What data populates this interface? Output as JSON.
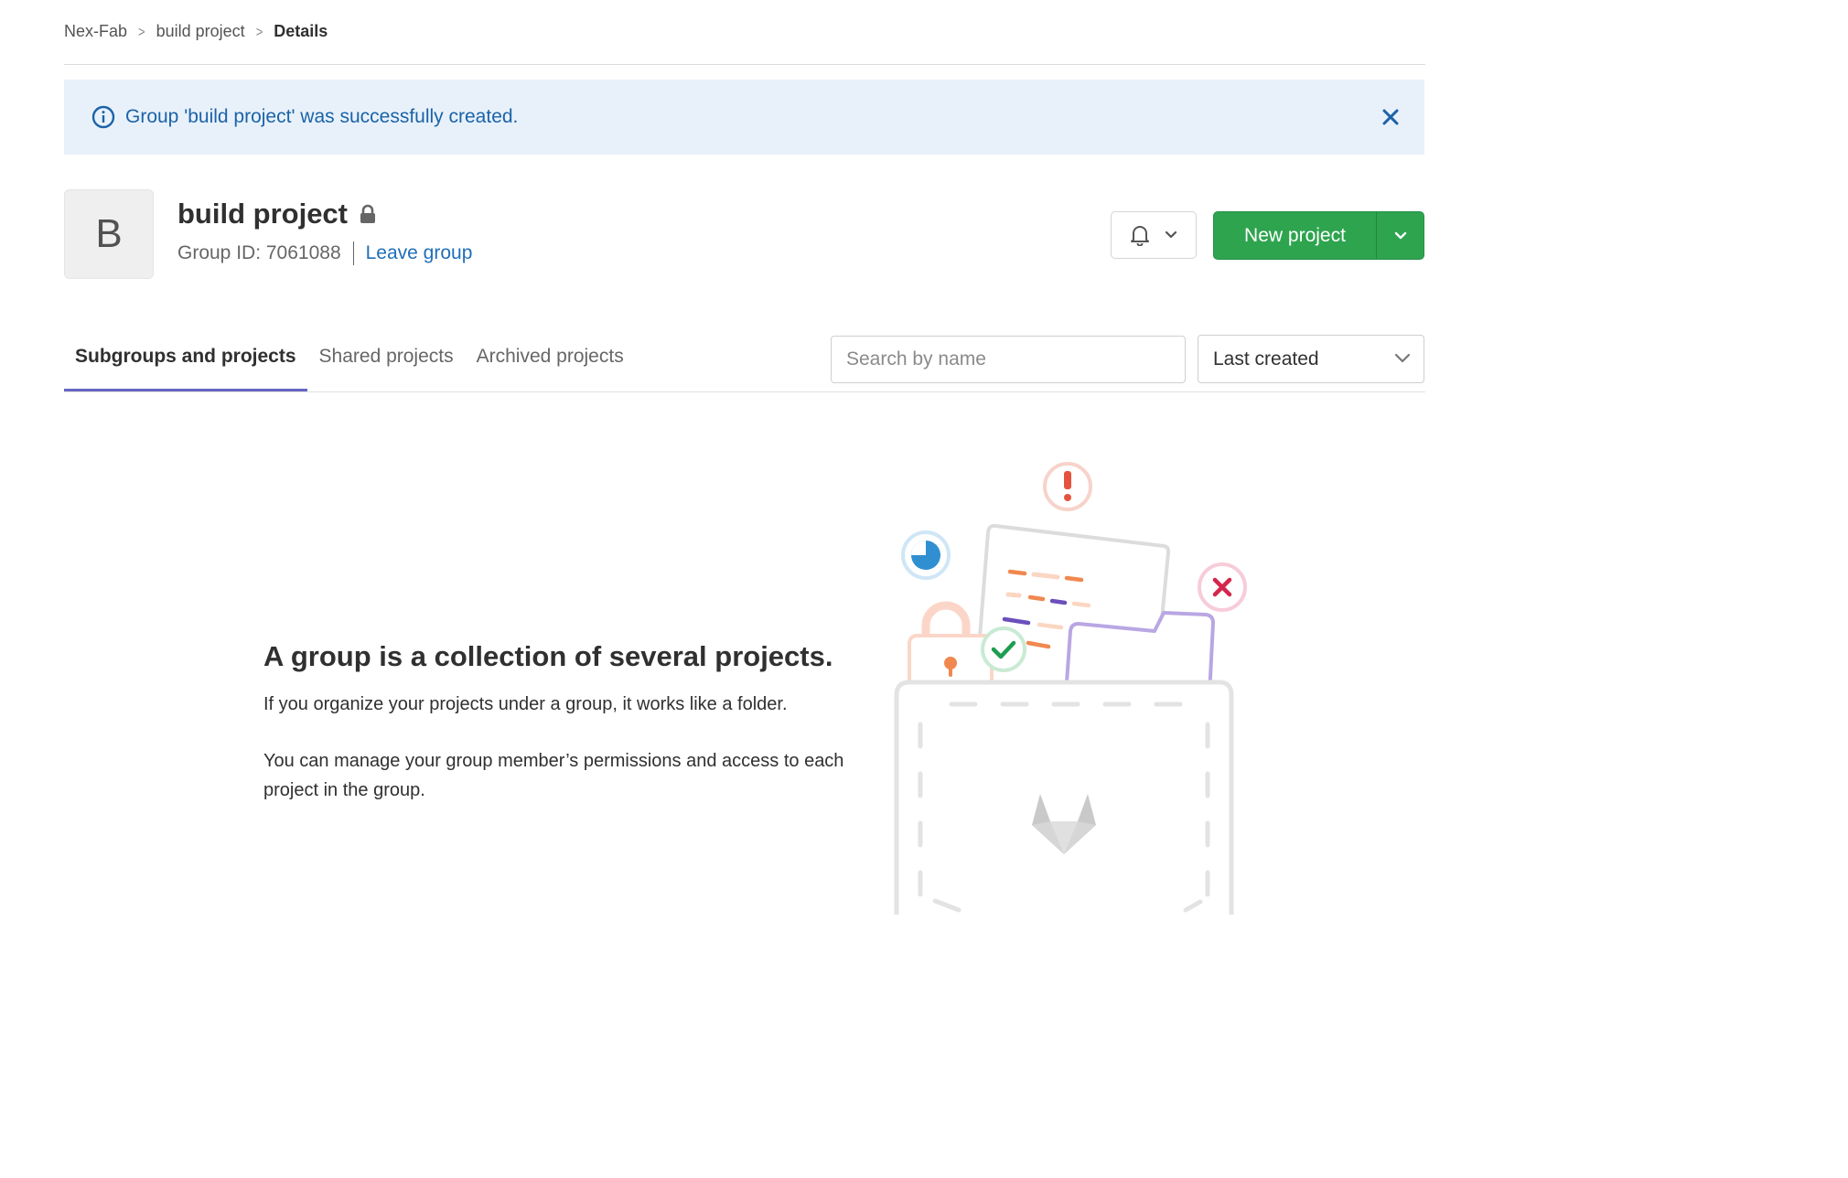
{
  "breadcrumb": {
    "items": [
      "Nex-Fab",
      "build project"
    ],
    "current": "Details"
  },
  "alert": {
    "message": "Group 'build project' was successfully created."
  },
  "group": {
    "avatar_letter": "B",
    "name": "build project",
    "id_text": "Group ID: 7061088",
    "leave_label": "Leave group"
  },
  "actions": {
    "new_project_label": "New project"
  },
  "tabs": [
    {
      "label": "Subgroups and projects",
      "active": true
    },
    {
      "label": "Shared projects",
      "active": false
    },
    {
      "label": "Archived projects",
      "active": false
    }
  ],
  "search": {
    "placeholder": "Search by name"
  },
  "sort": {
    "selected": "Last created"
  },
  "empty_state": {
    "title": "A group is a collection of several projects.",
    "line1": "If you organize your projects under a group, it works like a folder.",
    "line2": "You can manage your group member’s permissions and access to each project in the group."
  },
  "colors": {
    "alert_bg": "#e8f1fa",
    "alert_text": "#1b63a8",
    "primary_green": "#2ea44f",
    "active_tab_underline": "#6666c4",
    "link_blue": "#1f6fb8"
  },
  "icons": [
    "info-icon",
    "close-icon",
    "lock-icon",
    "bell-icon",
    "chevron-down-icon"
  ]
}
